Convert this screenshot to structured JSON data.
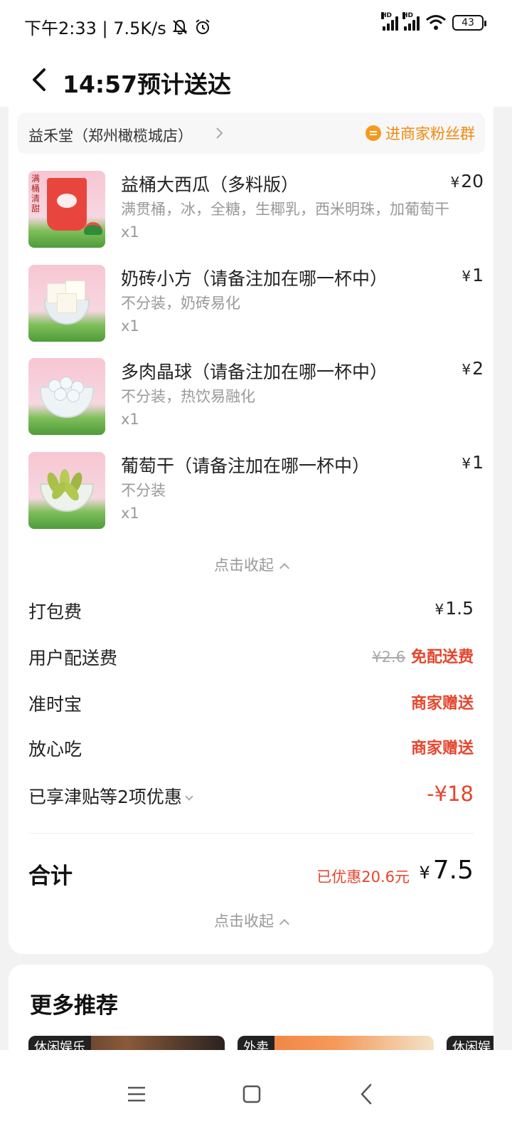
{
  "status_bar": {
    "time_speed": "下午2:33 | 7.5K/s",
    "battery": "43"
  },
  "header": {
    "title": "14:57预计送达"
  },
  "store": {
    "name": "益禾堂（郑州橄榄城店）",
    "fans_group_label": "进商家粉丝群"
  },
  "items": [
    {
      "name": "益桶大西瓜（多料版）",
      "spec": "满贯桶，冰，全糖，生椰乳，西米明珠，加葡萄干",
      "qty": "x1",
      "price": "20",
      "thumb_text": "满桶清甜"
    },
    {
      "name": "奶砖小方（请备注加在哪一杯中）",
      "spec": "不分装，奶砖易化",
      "qty": "x1",
      "price": "1"
    },
    {
      "name": "多肉晶球（请备注加在哪一杯中）",
      "spec": "不分装，热饮易融化",
      "qty": "x1",
      "price": "2"
    },
    {
      "name": "葡萄干（请备注加在哪一杯中）",
      "spec": "不分装",
      "qty": "x1",
      "price": "1"
    }
  ],
  "currency": "¥",
  "collapse_label": "点击收起",
  "fees": {
    "packing": {
      "label": "打包费",
      "value": "1.5"
    },
    "delivery": {
      "label": "用户配送费",
      "original": "¥2.6",
      "value": "免配送费"
    },
    "on_time": {
      "label": "准时宝",
      "value": "商家赠送"
    },
    "safe_eat": {
      "label": "放心吃",
      "value": "商家赠送"
    },
    "discount": {
      "label": "已享津贴等2项优惠",
      "value": "-¥18"
    }
  },
  "total": {
    "label": "合计",
    "saved": "已优惠20.6元",
    "value": "7.5"
  },
  "recommend": {
    "title": "更多推荐",
    "tiles": [
      {
        "tag": "休闲娱乐"
      },
      {
        "tag": "外卖"
      },
      {
        "tag": "休闲娱乐"
      }
    ]
  },
  "colors": {
    "accent_red": "#e5452d",
    "accent_orange": "#f08a0e",
    "text_gray": "#999999"
  }
}
